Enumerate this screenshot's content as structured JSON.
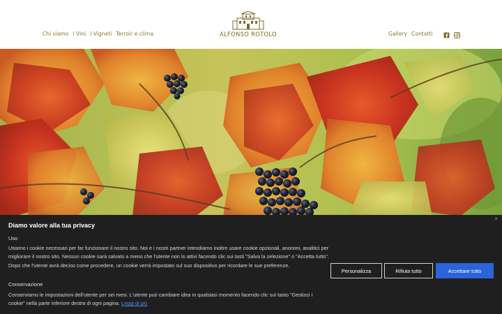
{
  "nav": {
    "left": [
      "Chi siamo",
      "I Vini",
      "I Vigneti",
      "Terroir e clima"
    ],
    "right": [
      "Gallery",
      "Contatti"
    ]
  },
  "logo": {
    "text": "ALFONSO ROTOLO"
  },
  "social": {
    "icons": [
      "facebook-icon",
      "instagram-icon"
    ],
    "color": "#7b6a2a"
  },
  "cookie": {
    "close": "×",
    "title": "Diamo valore alla tua privacy",
    "section1_label": "Uso",
    "section1_text": "Usiamo i cookie necessari per far funzionare il nostro sito. Noi e i nostri partner intendiamo inoltre usare cookie opzionali, anonimi, analitici per migliorare il nostro sito. Nessun cookie sarà salvato a meno che l'utente non lo attivi facendo clic sui tasti \"Salva la selezione\" o \"Accetta tutto\". Dopo che l'utente avrà deciso come procedere, un cookie verrà impostato sul suo dispositivo per ricordare le sue preferenze.",
    "section2_label": "Conservazione",
    "section2_text": "Conserviamo le impostazioni dell'utente per sei mesi. L'utente può cambiare idea in qualsiasi momento facendo clic sul tasto \"Gestisci i cookie\" nella parte inferiore destra di ogni pagina.",
    "more_link": "Leggi di più",
    "buttons": {
      "customize": "Personalizza",
      "reject": "Rifiuta tutto",
      "accept": "Accettare tutto"
    },
    "accent_color": "#2c63d8"
  }
}
